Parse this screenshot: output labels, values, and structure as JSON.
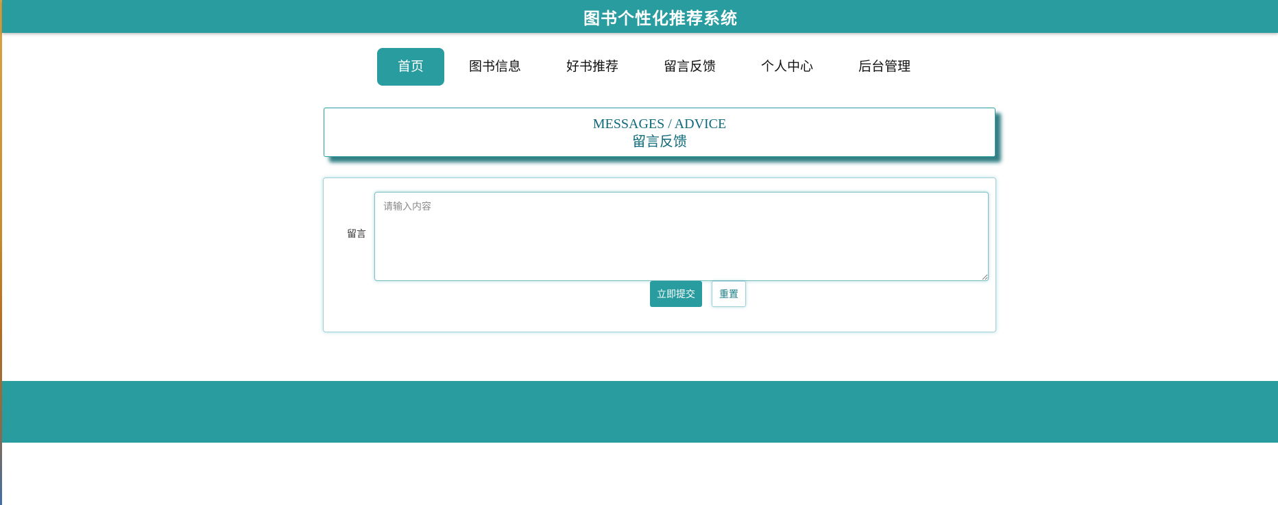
{
  "header": {
    "title": "图书个性化推荐系统"
  },
  "nav": {
    "items": [
      {
        "label": "首页",
        "active": true
      },
      {
        "label": "图书信息"
      },
      {
        "label": "好书推荐"
      },
      {
        "label": "留言反馈"
      },
      {
        "label": "个人中心"
      },
      {
        "label": "后台管理"
      }
    ]
  },
  "banner": {
    "en": "MESSAGES / ADVICE",
    "zh": "留言反馈"
  },
  "form": {
    "label": "留言",
    "placeholder": "请输入内容",
    "value": "",
    "submit_label": "立即提交",
    "reset_label": "重置"
  },
  "colors": {
    "accent": "#289c9f",
    "banner_text": "#0e6a7a"
  }
}
